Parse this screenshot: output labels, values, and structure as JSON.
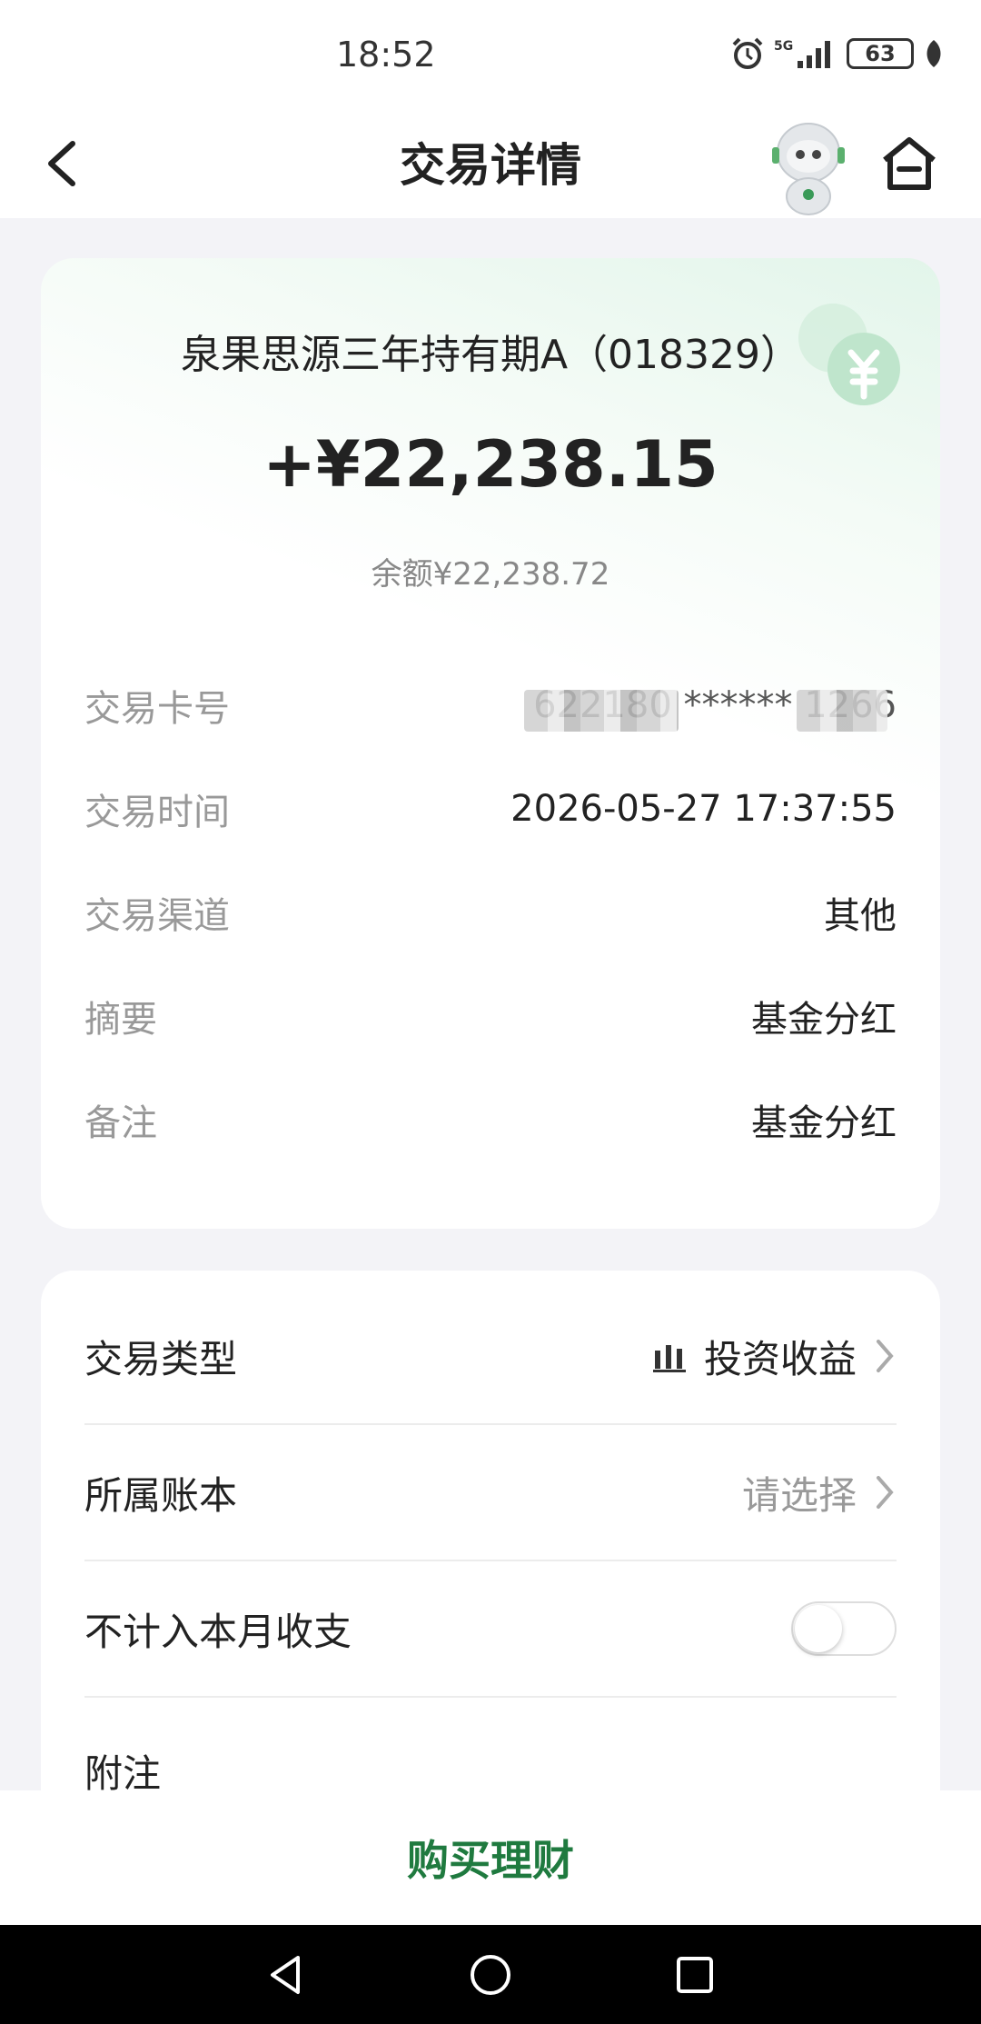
{
  "status_bar": {
    "time": "18:52",
    "network": "5G",
    "battery": "63"
  },
  "header": {
    "title": "交易详情",
    "back_icon": "chevron-left-icon",
    "assistant_icon": "robot-avatar-icon",
    "home_icon": "home-icon"
  },
  "transaction": {
    "fund_name": "泉果思源三年持有期A（018329）",
    "amount": "+¥22,238.15",
    "balance": "余额¥22,238.72",
    "details": [
      {
        "label": "交易卡号",
        "value": "622180 ****** 1266"
      },
      {
        "label": "交易时间",
        "value": "2026-05-27 17:37:55"
      },
      {
        "label": "交易渠道",
        "value": "其他"
      },
      {
        "label": "摘要",
        "value": "基金分红"
      },
      {
        "label": "备注",
        "value": "基金分红"
      }
    ]
  },
  "settings": {
    "type": {
      "label": "交易类型",
      "value": "投资收益",
      "icon": "bar-chart-icon"
    },
    "ledger": {
      "label": "所属账本",
      "placeholder": "请选择"
    },
    "exclude": {
      "label": "不计入本月收支",
      "enabled": false
    },
    "note": {
      "label": "附注"
    }
  },
  "bottom": {
    "buy_label": "购买理财"
  },
  "colors": {
    "accent": "#1f7a3f",
    "muted": "#999999"
  }
}
